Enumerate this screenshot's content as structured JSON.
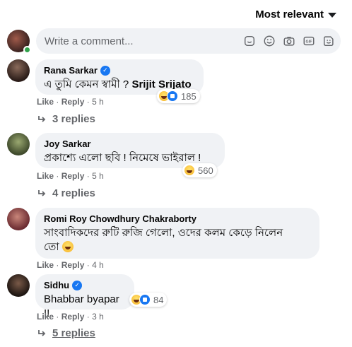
{
  "sort": {
    "label": "Most relevant"
  },
  "composer": {
    "placeholder": "Write a comment..."
  },
  "actions": {
    "like": "Like",
    "reply": "Reply",
    "sep": "·"
  },
  "comments": [
    {
      "name": "Rana Sarkar",
      "verified": true,
      "text_pre": "এ তুমি কেমন স্বামী ? ",
      "text_bold": "Srijit Srijato",
      "reaction_count": "185",
      "time": "5 h",
      "replies": "3 replies"
    },
    {
      "name": "Joy Sarkar",
      "verified": false,
      "text": "প্রকাশ্যে এলো ছবি ! নিমেষে ভাইরাল !",
      "reaction_count": "560",
      "time": "5 h",
      "replies": "4 replies"
    },
    {
      "name": "Romi Roy Chowdhury Chakraborty",
      "verified": false,
      "text_line1": "সাংবাদিকদের রুটি রুজি গেলো, ওদের কলম কেড়ে নিলেন",
      "text_line2": "তো",
      "time": "4 h"
    },
    {
      "name": "Sidhu",
      "verified": true,
      "text": "Bhabbar byapar !!",
      "reaction_count": "84",
      "time": "3 h",
      "replies": "5 replies"
    }
  ],
  "icons": [
    "sticker-icon",
    "emoji-icon",
    "camera-icon",
    "gif-icon",
    "avatar-sticker-icon",
    "reply-arrow-icon",
    "verified-badge-icon",
    "haha-reaction-icon",
    "like-reaction-icon",
    "chevron-down-icon"
  ],
  "colors": {
    "accent": "#1877f2",
    "bubble": "#f0f2f5",
    "muted": "#65676b",
    "online": "#31a24c"
  }
}
